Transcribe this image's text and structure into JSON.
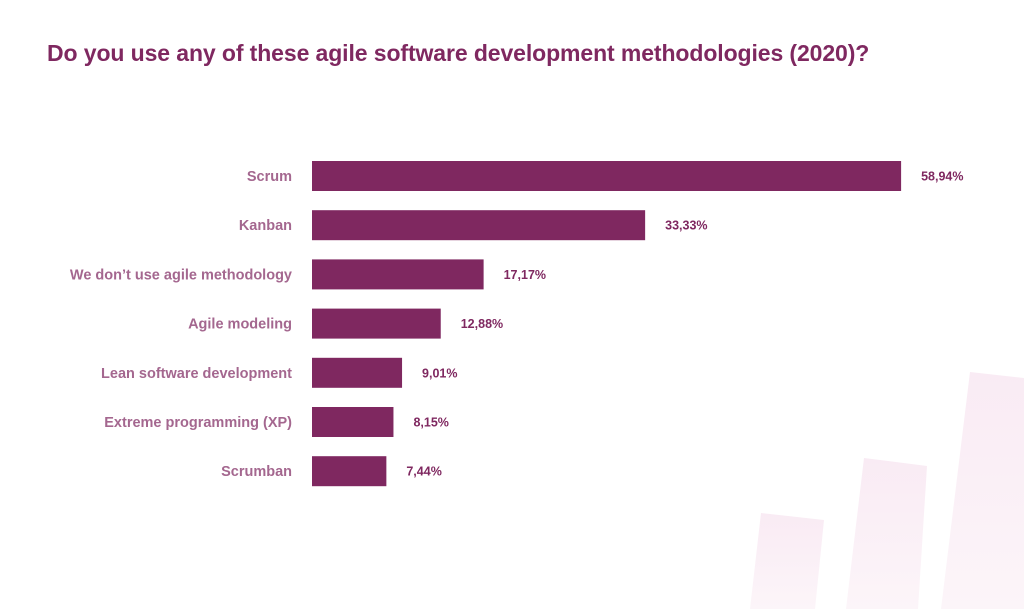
{
  "chart_data": {
    "type": "bar",
    "orientation": "horizontal",
    "title": "Do you use any of these agile software development methodologies (2020)?",
    "categories": [
      "Scrum",
      "Kanban",
      "We don’t use agile methodology",
      "Agile modeling",
      "Lean software development",
      "Extreme programming (XP)",
      "Scrumban"
    ],
    "values": [
      58.94,
      33.33,
      17.17,
      12.88,
      9.01,
      8.15,
      7.44
    ],
    "value_labels": [
      "58,94%",
      "33,33%",
      "17,17%",
      "12,88%",
      "9,01%",
      "8,15%",
      "7,44%"
    ],
    "unit": "%",
    "xlabel": "",
    "ylabel": "",
    "xlim": [
      0,
      60
    ],
    "grid": false,
    "legend": "none",
    "bar_color": "#7f2860",
    "label_color": "#a4678f",
    "title_color": "#7f2860",
    "decoration_color": "#f7e8f2"
  }
}
